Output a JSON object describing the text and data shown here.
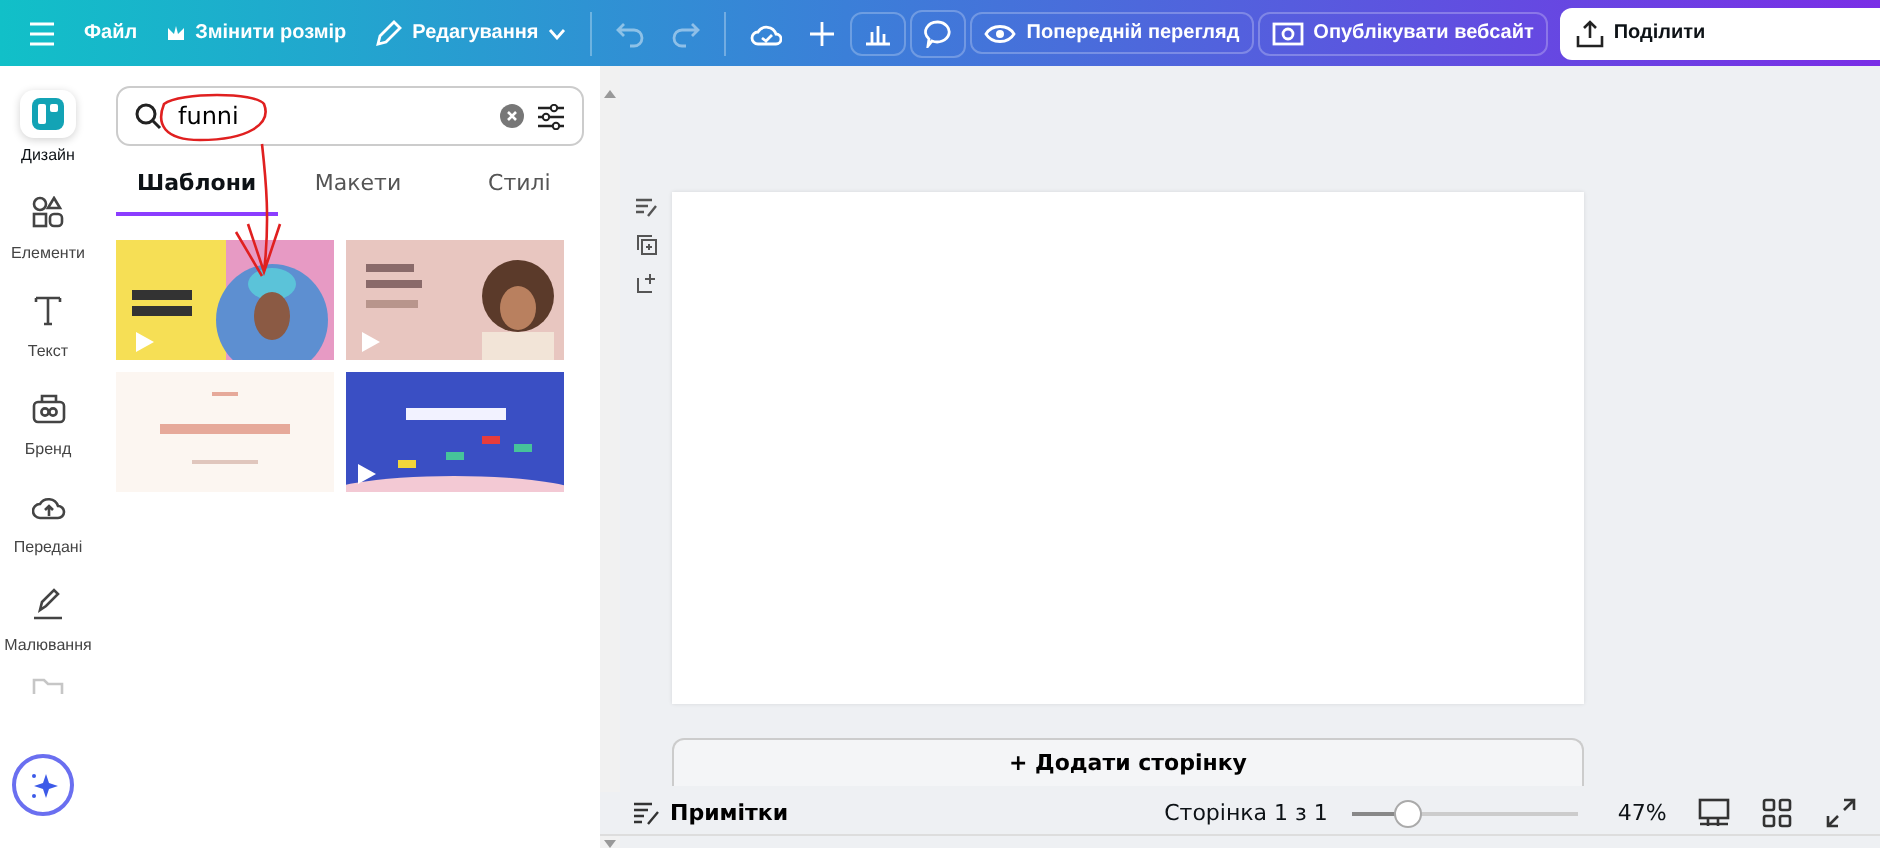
{
  "toolbar": {
    "menu": [
      {
        "label": "Файл"
      },
      {
        "label": "Змінити розмір"
      },
      {
        "label": "Редагування"
      }
    ],
    "preview": "Попередній перегляд",
    "publish": "Опублікувати вебсайт",
    "share": "Поділити"
  },
  "sidebar": {
    "items": [
      {
        "label": "Дизайн",
        "selected": true
      },
      {
        "label": "Елементи",
        "selected": false
      },
      {
        "label": "Текст",
        "selected": false
      },
      {
        "label": "Бренд",
        "selected": false
      },
      {
        "label": "Передані",
        "selected": false
      },
      {
        "label": "Малювання",
        "selected": false
      }
    ]
  },
  "panel": {
    "search": {
      "value": "funni"
    },
    "tabs": [
      {
        "label": "Шаблони",
        "selected": true
      },
      {
        "label": "Макети",
        "selected": false
      },
      {
        "label": "Стилі",
        "selected": false
      }
    ]
  },
  "canvas": {
    "add_page": "+ Додати сторінку"
  },
  "status_bar": {
    "notes": "Примітки",
    "page": "Сторінка 1 з 1",
    "zoom": {
      "level": 0.25
    },
    "zoom_reading": "47%"
  }
}
